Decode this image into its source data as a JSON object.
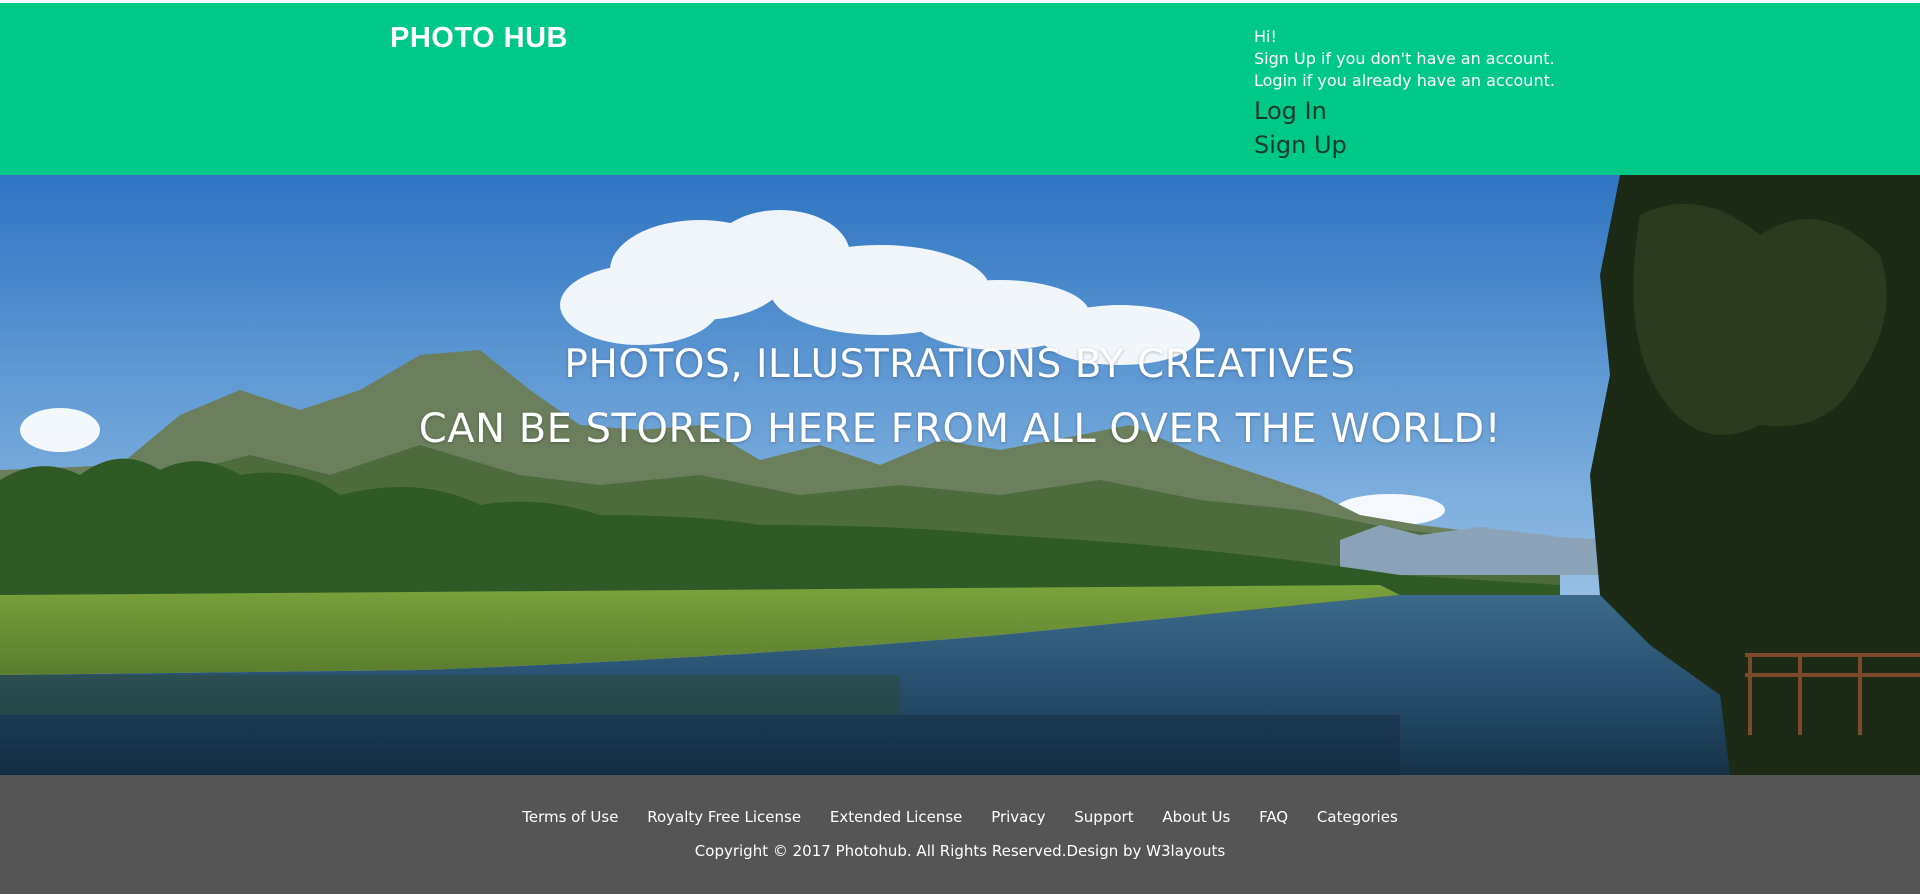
{
  "header": {
    "brand": "PHOTO HUB",
    "greeting": "Hi!",
    "signup_hint": "Sign Up if you don't have an account.",
    "login_hint": "Login if you already have an account.",
    "login_link": "Log In",
    "signup_link": "Sign Up"
  },
  "hero": {
    "line1": "PHOTOS, ILLUSTRATIONS BY CREATIVES",
    "line2": "CAN BE STORED HERE FROM ALL OVER THE WORLD!"
  },
  "footer": {
    "links": [
      "Terms of Use",
      "Royalty Free License",
      "Extended License",
      "Privacy",
      "Support",
      "About Us",
      "FAQ",
      "Categories"
    ],
    "copyright": "Copyright © 2017 Photohub. All Rights Reserved.Design by W3layouts"
  },
  "colors": {
    "header_bg": "#00c887",
    "footer_bg": "#555555",
    "link_dark": "#1b3a2c"
  }
}
